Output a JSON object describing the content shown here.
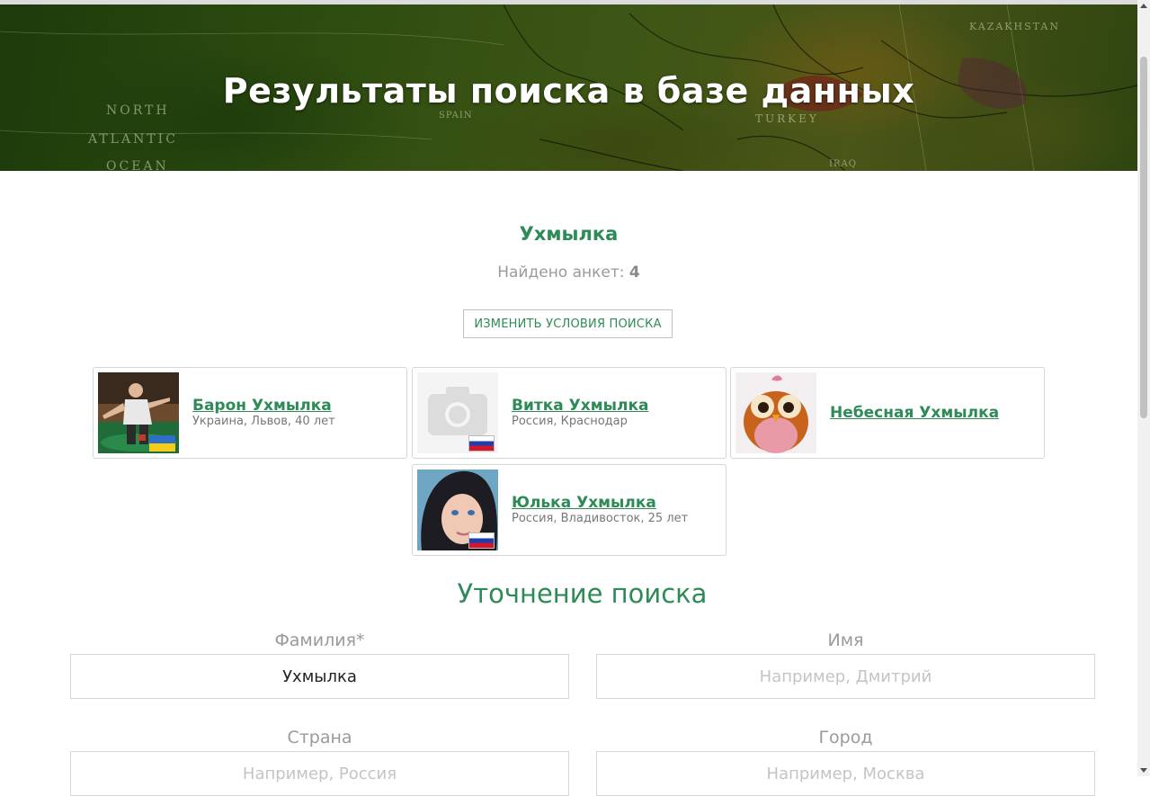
{
  "hero": {
    "title": "Результаты поиска в базе данных",
    "map_labels": [
      "NORTH",
      "ATLANTIC",
      "OCEAN",
      "SPAIN",
      "TURKEY",
      "IRAQ",
      "KAZAKHSTAN"
    ]
  },
  "search": {
    "query": "Ухмылка",
    "found_label": "Найдено анкет:",
    "found_count": "4",
    "change_button": "ИЗМЕНИТЬ УСЛОВИЯ ПОИСКА"
  },
  "results": [
    {
      "name": "Барон Ухмылка",
      "details": "Украина, Львов, 40 лет",
      "flag": "ukraine-flag"
    },
    {
      "name": "Витка Ухмылка",
      "details": "Россия, Краснодар",
      "flag": "russia-flag"
    },
    {
      "name": "Небесная Ухмылка",
      "details": "",
      "flag": ""
    },
    {
      "name": "Юлька Ухмылка",
      "details": "Россия, Владивосток, 25 лет",
      "flag": "russia-flag"
    }
  ],
  "refine": {
    "title": "Уточнение поиска",
    "surname_label": "Фамилия*",
    "surname_value": "Ухмылка",
    "name_label": "Имя",
    "name_placeholder": "Например, Дмитрий",
    "country_label": "Страна",
    "country_placeholder": "Например, Россия",
    "city_label": "Город",
    "city_placeholder": "Например, Москва"
  },
  "colors": {
    "accent": "#2e8b57",
    "muted_text": "#9a9a9a",
    "border": "#d6d6d6"
  }
}
